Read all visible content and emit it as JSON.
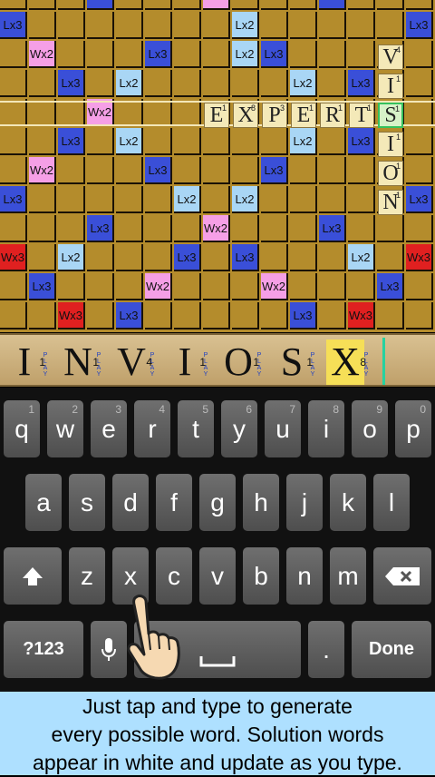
{
  "board": {
    "premium_cells": [
      {
        "label": "Lx3",
        "color": "#3a4fd8"
      },
      {
        "label": "Lx2",
        "color": "#a9d6f5"
      },
      {
        "label": "Lx2",
        "color": "#a9d6f5"
      },
      {
        "label": "Lx3",
        "color": "#3a4fd8"
      },
      {
        "label": "Wx2",
        "color": "#f59fe6"
      },
      {
        "label": "Lx3",
        "color": "#3a4fd8"
      },
      {
        "label": "Lx3",
        "color": "#3a4fd8"
      },
      {
        "label": "Lx3",
        "color": "#3a4fd8"
      },
      {
        "label": "Lx2",
        "color": "#a9d6f5"
      },
      {
        "label": "Lx2",
        "color": "#a9d6f5"
      },
      {
        "label": "Lx3",
        "color": "#3a4fd8"
      },
      {
        "label": "Wx2",
        "color": "#f59fe6"
      },
      {
        "label": "Lx3",
        "color": "#3a4fd8"
      },
      {
        "label": "Lx2",
        "color": "#a9d6f5"
      },
      {
        "label": "Lx2",
        "color": "#a9d6f5"
      },
      {
        "label": "Lx3",
        "color": "#3a4fd8"
      },
      {
        "label": "Wx2",
        "color": "#f59fe6"
      },
      {
        "label": "Lx3",
        "color": "#3a4fd8"
      },
      {
        "label": "Lx3",
        "color": "#3a4fd8"
      },
      {
        "label": "Lx3",
        "color": "#3a4fd8"
      },
      {
        "label": "Lx2",
        "color": "#a9d6f5"
      },
      {
        "label": "Lx2",
        "color": "#a9d6f5"
      },
      {
        "label": "Lx3",
        "color": "#3a4fd8"
      },
      {
        "label": "Lx3",
        "color": "#3a4fd8"
      },
      {
        "label": "Wx2",
        "color": "#f59fe6"
      },
      {
        "label": "Lx3",
        "color": "#3a4fd8"
      },
      {
        "label": "Wx3",
        "color": "#e02020"
      },
      {
        "label": "Lx2",
        "color": "#a9d6f5"
      },
      {
        "label": "Lx3",
        "color": "#3a4fd8"
      },
      {
        "label": "Lx3",
        "color": "#3a4fd8"
      },
      {
        "label": "Lx2",
        "color": "#a9d6f5"
      },
      {
        "label": "Wx3",
        "color": "#e02020"
      },
      {
        "label": "Lx3",
        "color": "#3a4fd8"
      },
      {
        "label": "Wx2",
        "color": "#f59fe6"
      },
      {
        "label": "Wx2",
        "color": "#f59fe6"
      },
      {
        "label": "Lx3",
        "color": "#3a4fd8"
      },
      {
        "label": "Wx3",
        "color": "#e02020"
      },
      {
        "label": "Lx3",
        "color": "#3a4fd8"
      },
      {
        "label": "Lx3",
        "color": "#3a4fd8"
      },
      {
        "label": "Wx3",
        "color": "#e02020"
      },
      {
        "label": "Lx3",
        "color": "#3a4fd8"
      },
      {
        "label": "Wx2",
        "color": "#f59fe6"
      },
      {
        "label": "Lx3",
        "color": "#3a4fd8"
      }
    ],
    "word_across": [
      {
        "letter": "E",
        "score": "1"
      },
      {
        "letter": "X",
        "score": "8"
      },
      {
        "letter": "P",
        "score": "3"
      },
      {
        "letter": "E",
        "score": "1"
      },
      {
        "letter": "R",
        "score": "1"
      },
      {
        "letter": "T",
        "score": "1"
      },
      {
        "letter": "S",
        "score": "1"
      }
    ],
    "word_down": [
      {
        "letter": "V",
        "score": "4"
      },
      {
        "letter": "I",
        "score": "1"
      },
      {
        "letter": "S",
        "score": "1"
      },
      {
        "letter": "I",
        "score": "1"
      },
      {
        "letter": "O",
        "score": "1"
      },
      {
        "letter": "N",
        "score": "1"
      }
    ]
  },
  "rack": {
    "tiles": [
      {
        "letter": "I",
        "score": "1",
        "play": "PLAY"
      },
      {
        "letter": "N",
        "score": "1",
        "play": "PLAY"
      },
      {
        "letter": "V",
        "score": "4",
        "play": "PLAY"
      },
      {
        "letter": "I",
        "score": "1",
        "play": "PLAY"
      },
      {
        "letter": "O",
        "score": "1",
        "play": "PLAY"
      },
      {
        "letter": "S",
        "score": "1",
        "play": "PLAY"
      },
      {
        "letter": "X",
        "score": "8",
        "play": "PLAY"
      }
    ]
  },
  "keyboard": {
    "row1": [
      {
        "label": "q",
        "hint": "1"
      },
      {
        "label": "w",
        "hint": "2"
      },
      {
        "label": "e",
        "hint": "3"
      },
      {
        "label": "r",
        "hint": "4"
      },
      {
        "label": "t",
        "hint": "5"
      },
      {
        "label": "y",
        "hint": "6"
      },
      {
        "label": "u",
        "hint": "7"
      },
      {
        "label": "i",
        "hint": "8"
      },
      {
        "label": "o",
        "hint": "9"
      },
      {
        "label": "p",
        "hint": "0"
      }
    ],
    "row2": [
      "a",
      "s",
      "d",
      "f",
      "g",
      "h",
      "j",
      "k",
      "l"
    ],
    "row3": [
      "z",
      "x",
      "c",
      "v",
      "b",
      "n",
      "m"
    ],
    "symbols_label": "?123",
    "period_label": ".",
    "done_label": "Done",
    "icons": {
      "shift": "shift-icon",
      "delete": "backspace-icon",
      "mic": "microphone-icon",
      "space": "spacebar-icon"
    }
  },
  "caption": {
    "line1": "Just tap and type to generate",
    "line2": "every possible word.  Solution words",
    "line3": "appear in white and update as you type."
  }
}
